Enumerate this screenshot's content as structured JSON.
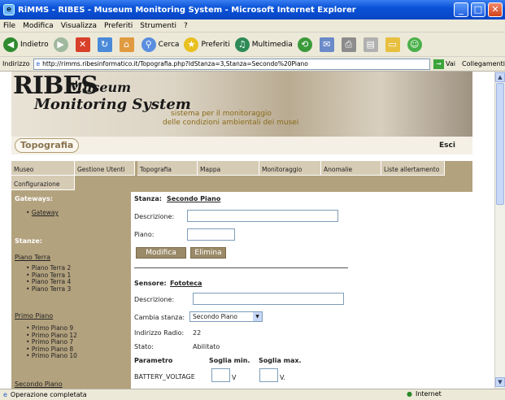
{
  "window": {
    "title": "RiMMS - RIBES - Museum Monitoring System - Microsoft Internet Explorer"
  },
  "menu": [
    "File",
    "Modifica",
    "Visualizza",
    "Preferiti",
    "Strumenti",
    "?"
  ],
  "toolbar": {
    "back": "Indietro",
    "search": "Cerca",
    "favorites": "Preferiti",
    "media": "Multimedia"
  },
  "address": {
    "label": "Indirizzo",
    "url": "http://rimms.ribesinformatico.it/Topografia.php?IdStanza=3,Stanza=Secondo%20Piano",
    "go": "Vai",
    "links": "Collegamenti"
  },
  "banner": {
    "logo_ribes": "RIBES",
    "logo_museum": "Museum",
    "logo_monitoring": "Monitoring System",
    "tagline1": "sistema per il monitoraggio",
    "tagline2": "delle condizioni ambientali dei musei"
  },
  "page_title": "Topografia",
  "logout": "Esci",
  "nav": [
    "Museo",
    "Gestione Utenti",
    "Topografia",
    "Mappa",
    "Monitoraggio",
    "Anomalie",
    "Liste allertamento",
    "Configurazione"
  ],
  "sidebar": {
    "gateways_heading": "Gateways:",
    "gateway_item": "Gateway",
    "stanze_heading": "Stanze:",
    "groups": [
      {
        "name": "Piano Terra",
        "rooms": [
          "Piano Terra 2",
          "Piano Terra 1",
          "Piano Terra 4",
          "Piano Terra 3"
        ]
      },
      {
        "name": "Primo Piano",
        "rooms": [
          "Primo Piano 9",
          "Primo Piano 12",
          "Primo Piano 7",
          "Primo Piano 8",
          "Primo Piano 10"
        ]
      },
      {
        "name": "Secondo Piano",
        "rooms": []
      }
    ]
  },
  "stanza": {
    "label": "Stanza:",
    "name": "Secondo Piano",
    "descrizione_label": "Descrizione:",
    "piano_label": "Piano:",
    "btn_modifica": "Modifica",
    "btn_elimina": "Elimina"
  },
  "sensore": {
    "label": "Sensore:",
    "name": "Fototeca",
    "descrizione_label": "Descrizione:",
    "cambia_label": "Cambia stanza:",
    "cambia_value": "Secondo Piano",
    "radio_label": "Indirizzo Radio:",
    "radio_value": "22",
    "stato_label": "Stato:",
    "stato_value": "Abilitato",
    "col_param": "Parametro",
    "col_min": "Soglia min.",
    "col_max": "Soglia max.",
    "row_param": "BATTERY_VOLTAGE",
    "unit_min": "V",
    "unit_max": "V."
  },
  "status": {
    "text": "Operazione completata",
    "zone": "Internet"
  }
}
